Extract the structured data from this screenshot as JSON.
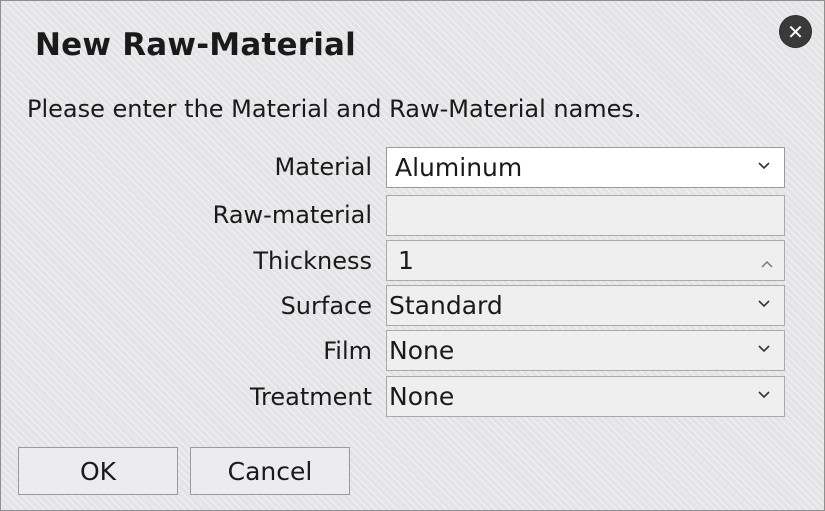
{
  "dialog": {
    "title": "New Raw-Material",
    "instructions": "Please enter the Material and Raw-Material names."
  },
  "fields": {
    "material": {
      "label": "Material",
      "value": "Aluminum"
    },
    "raw_material": {
      "label": "Raw-material",
      "value": ""
    },
    "thickness": {
      "label": "Thickness",
      "value": "1"
    },
    "surface": {
      "label": "Surface",
      "value": "Standard"
    },
    "film": {
      "label": "Film",
      "value": "None"
    },
    "treatment": {
      "label": "Treatment",
      "value": "None"
    }
  },
  "buttons": {
    "ok": "OK",
    "cancel": "Cancel"
  },
  "icons": {
    "close": "close-icon",
    "dropdown": "chevron-down-icon",
    "spinner_up": "chevron-up-icon",
    "spinner_down": "chevron-down-icon"
  }
}
